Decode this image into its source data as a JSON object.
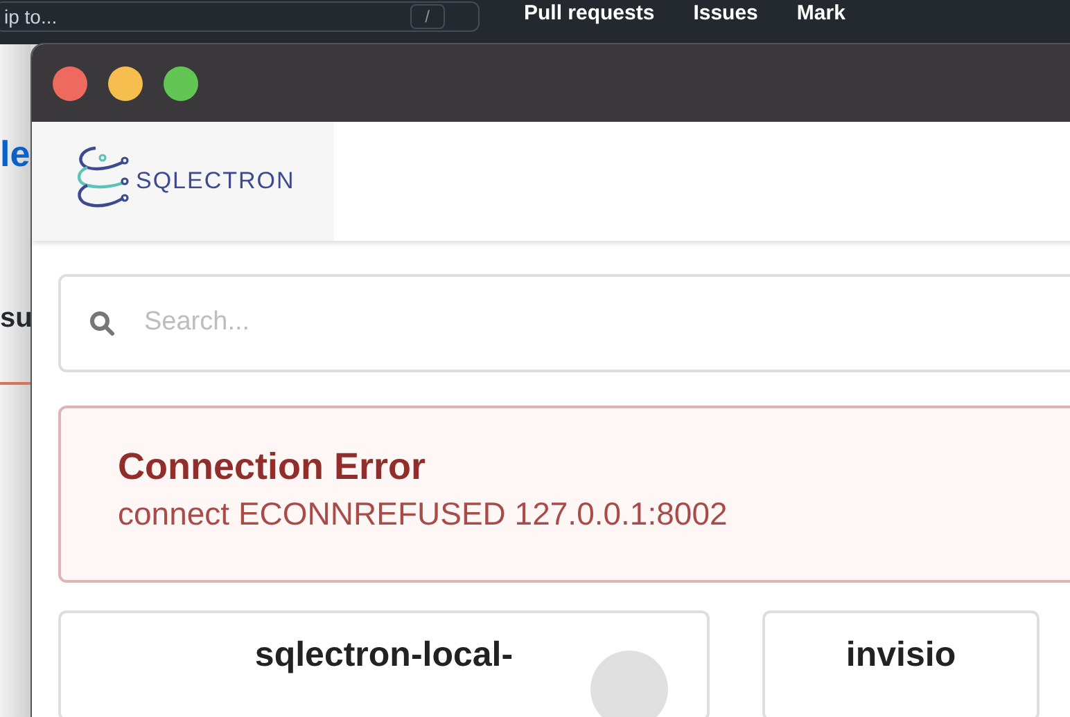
{
  "background_page": {
    "header": {
      "search_hint": "ip to...",
      "search_key": "/",
      "nav": [
        "Pull requests",
        "Issues",
        "Mark"
      ]
    },
    "fragments": [
      "le",
      "su"
    ]
  },
  "logo": {
    "text": "SQLECTRON"
  },
  "search": {
    "placeholder": "Search..."
  },
  "error": {
    "title": "Connection Error",
    "message": "connect ECONNREFUSED 127.0.0.1:8002"
  },
  "servers": [
    {
      "name": "sqlectron-local-",
      "has_action": true
    },
    {
      "name": "invisio",
      "has_action": false
    }
  ]
}
